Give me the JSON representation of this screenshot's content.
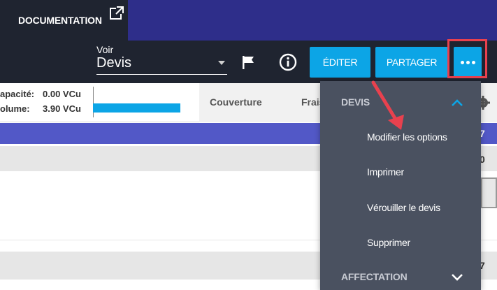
{
  "header": {
    "doc_tab": "DOCUMENTATION",
    "external_link_icon": "external-link-icon"
  },
  "toolbar": {
    "voir_label": "Voir",
    "voir_value": "Devis",
    "flag_icon": "flag-icon",
    "info_icon": "info-icon",
    "edit_label": "ÉDITER",
    "share_label": "PARTAGER",
    "more_icon": "more-dots-icon"
  },
  "stats": {
    "capacity_label": "apacité:",
    "capacity_value": "0.00 VCu",
    "volume_label": "olume:",
    "volume_value": "3.90 VCu",
    "col_couverture": "Couverture",
    "col_frais": "Frais"
  },
  "edge_values": {
    "row1": "7",
    "row2": "0",
    "row3": "7"
  },
  "menu": {
    "section_devis": "DEVIS",
    "items": [
      "Modifier les options",
      "Imprimer",
      "Vérouiller le devis",
      "Supprimer"
    ],
    "section_affectation": "AFFECTATION"
  },
  "colors": {
    "topbar": "#2e2e8a",
    "toolbar": "#1f2430",
    "accent": "#0ca5e6",
    "menu_bg": "#4a5160",
    "highlight": "#e8414e",
    "band": "#5258c7"
  }
}
